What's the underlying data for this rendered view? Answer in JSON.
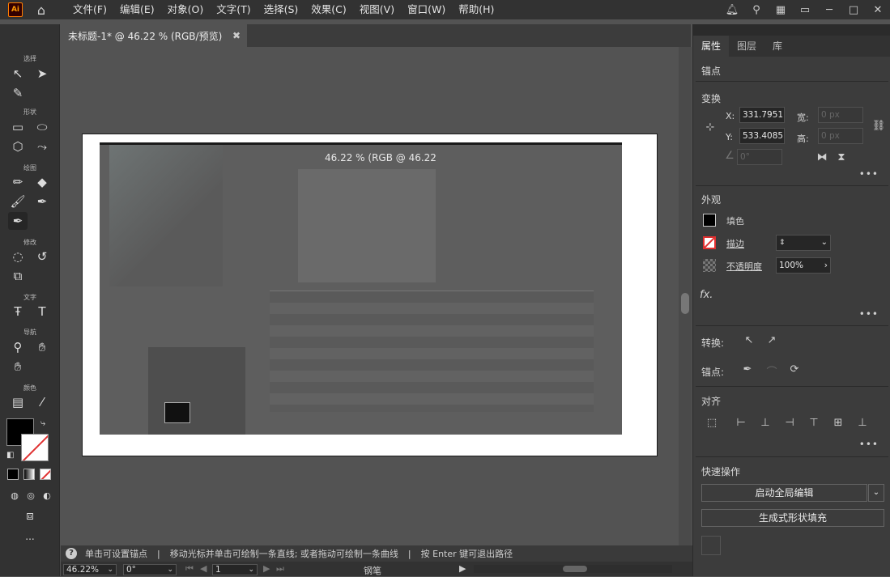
{
  "app": {
    "logo": "Ai",
    "home_icon": "home-icon"
  },
  "menu": [
    "文件(F)",
    "编辑(E)",
    "对象(O)",
    "文字(T)",
    "选择(S)",
    "效果(C)",
    "视图(V)",
    "窗口(W)",
    "帮助(H)"
  ],
  "toolbar": {
    "sections": {
      "select": "选择",
      "shape": "形状",
      "draw": "绘图",
      "modify": "修改",
      "type": "文字",
      "nav": "导航",
      "color": "颜色"
    },
    "more": "..."
  },
  "document": {
    "tab_title": "未标题-1* @ 46.22 % (RGB/预览)",
    "pasted_caption": "46.22 % (RGB @ 46.22"
  },
  "status": {
    "help": "单击可设置锚点",
    "sep1": "|",
    "hint": "移动光标并单击可绘制一条直线; 或者拖动可绘制一条曲线",
    "sep2": "|",
    "exit": "按 Enter 键可退出路径",
    "zoom": "46.22%",
    "rotate": "0°",
    "artboard": "1",
    "tool": "钢笔"
  },
  "panel": {
    "tabs": [
      "属性",
      "图层",
      "库"
    ],
    "context": "锚点",
    "transform": {
      "title": "变换",
      "x_label": "X:",
      "x_value": "331.7951",
      "y_label": "Y:",
      "y_value": "533.4085",
      "w_label": "宽:",
      "w_value": "0 px",
      "h_label": "高:",
      "h_value": "0 px",
      "angle_value": "0°"
    },
    "appearance": {
      "title": "外观",
      "fill": "填色",
      "stroke": "描边",
      "opacity": "不透明度",
      "opacity_value": "100%",
      "fx": "fx."
    },
    "convert": "转换:",
    "anchor": "锚点:",
    "align": "对齐",
    "quick": {
      "title": "快速操作",
      "global_edit": "启动全局编辑",
      "shape_fill": "生成式形状填充"
    }
  }
}
